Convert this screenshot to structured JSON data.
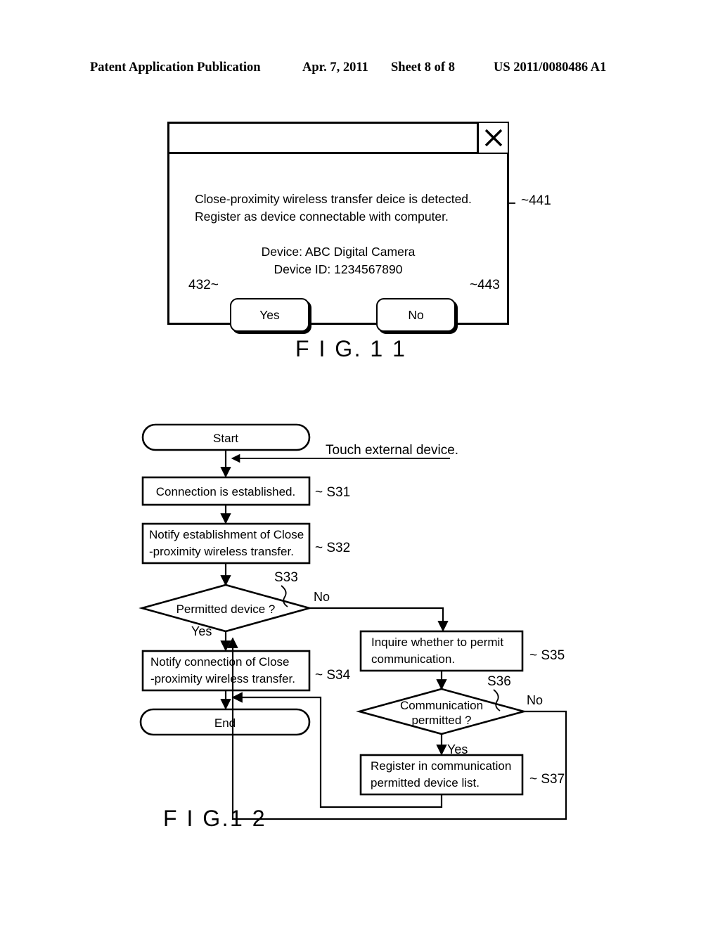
{
  "header": {
    "publication": "Patent Application Publication",
    "date": "Apr. 7, 2011",
    "sheet": "Sheet 8 of 8",
    "patent_number": "US 2011/0080486 A1"
  },
  "fig11": {
    "caption": "F I G. 1 1",
    "dialog": {
      "close_icon": "close-x-icon",
      "message_line1": "Close-proximity wireless transfer deice is detected.",
      "message_line2": "Register as device connectable with computer.",
      "device_line": "Device: ABC Digital Camera",
      "device_id_line": "Device ID: 1234567890",
      "yes_label": "Yes",
      "no_label": "No"
    },
    "refs": {
      "dialog_ref": "~441",
      "yes_ref": "432~",
      "no_ref": "~443"
    }
  },
  "fig12": {
    "caption": "F I G.1 2",
    "nodes": {
      "start": "Start",
      "end": "End",
      "s31": "Connection is established.",
      "s32_line1": "Notify establishment of Close",
      "s32_line2": "-proximity wireless transfer.",
      "s33_line1": "Permitted device ?",
      "s34_line1": "Notify connection of Close",
      "s34_line2": "-proximity wireless transfer.",
      "s35_line1": "Inquire whether to permit",
      "s35_line2": "communication.",
      "s36_line1": "Communication",
      "s36_line2": "permitted ?",
      "s37_line1": "Register in communication",
      "s37_line2": "permitted device list."
    },
    "step_refs": {
      "s31": "~ S31",
      "s32": "~ S32",
      "s33": "S33",
      "s34": "~ S34",
      "s35": "~ S35",
      "s36": "S36",
      "s37": "~ S37"
    },
    "branch_labels": {
      "s33_no": "No",
      "s33_yes": "Yes",
      "s36_no": "No",
      "s36_yes": "Yes"
    },
    "annotations": {
      "touch": "Touch external device."
    }
  }
}
